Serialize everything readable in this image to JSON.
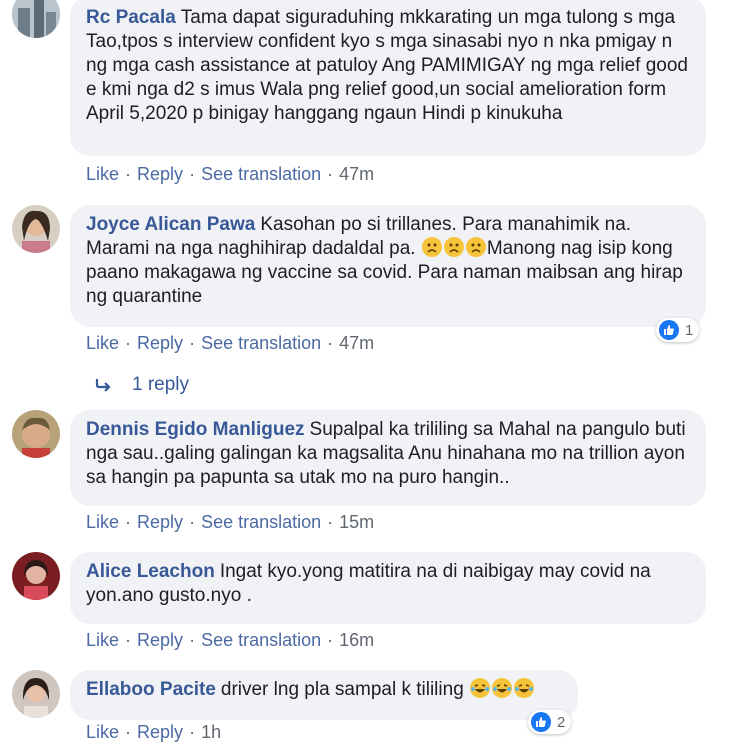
{
  "actions": {
    "like": "Like",
    "reply": "Reply",
    "see_translation": "See translation",
    "sep": "·"
  },
  "comments": [
    {
      "author": "Rc Pacala",
      "text": "Tama dapat siguraduhing mkkarating un mga tulong s mga Tao,tpos s interview confident kyo s mga sinasabi nyo n nka pmigay n ng mga cash assistance at patuloy Ang PAMIMIGAY ng mga relief good e kmi nga d2 s imus Wala png relief good,un social amelioration form April 5,2020 p binigay hanggang ngaun Hindi p kinukuha",
      "time": "47m"
    },
    {
      "author": "Joyce Alican Pawa",
      "text": "Kasohan po si trillanes. Para manahimik na. Marami na nga naghihirap dadaldal pa.",
      "text2": "Manong nag isip kong paano makagawa ng vaccine sa covid. Para naman maibsan ang hirap ng quarantine",
      "time": "47m",
      "reactions": "1"
    },
    {
      "author": "Dennis Egido Manliguez",
      "text": "Supalpal ka trililing sa Mahal na pangulo buti nga sau..galing galingan ka magsalita Anu hinahana mo na trillion ayon sa hangin pa papunta sa utak mo na puro hangin..",
      "time": "15m"
    },
    {
      "author": "Alice Leachon",
      "text": "Ingat kyo.yong matitira na di naibigay may covid na yon.ano gusto.nyo .",
      "time": "16m"
    },
    {
      "author": "Ellaboo Pacite",
      "text": "driver lng pla sampal k tililing",
      "time": "1h",
      "reactions": "2"
    }
  ],
  "replies_link": "1 reply",
  "colors": {
    "link": "#385898",
    "bubble": "#f0f2f5",
    "like_blue": "#1877f2"
  }
}
